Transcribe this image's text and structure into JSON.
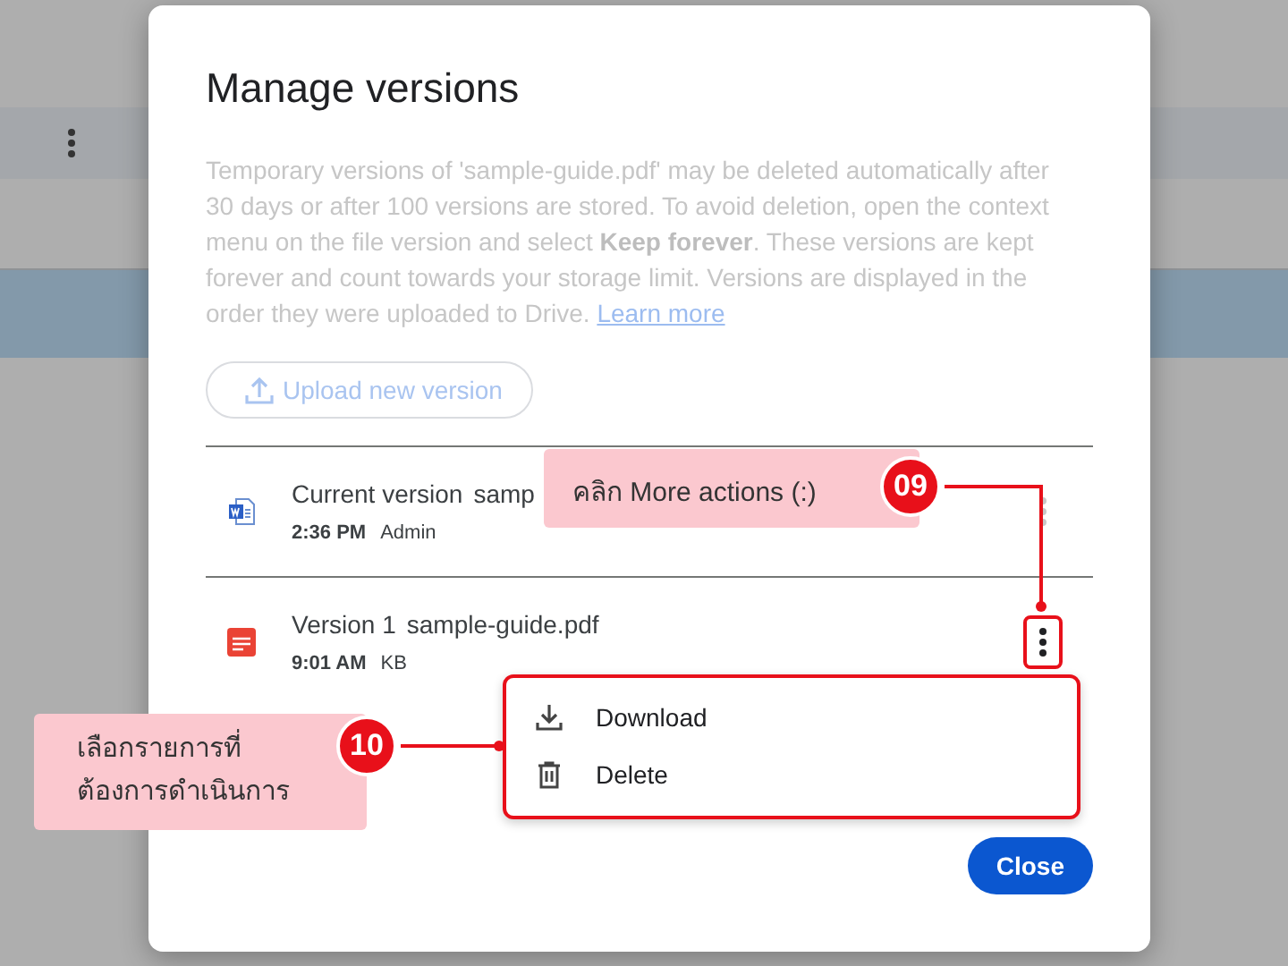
{
  "dialog": {
    "title": "Manage versions",
    "description": "Temporary versions of 'sample-guide.pdf' may be deleted automatically after 30 days or after 100 versions are stored. To avoid deletion, open the context menu on the file version and select **Keep forever**. These versions are kept forever and count towards your storage limit. Versions are displayed in the order they were uploaded to Drive.",
    "link": "Learn more",
    "upload_button": "Upload new version",
    "versions": [
      {
        "name": "Current version",
        "file": "samp",
        "time": "2:36 PM",
        "owner": "Admin",
        "kind": "word",
        "highlighted": false
      },
      {
        "name": "Version 1",
        "file": "sample-guide.pdf",
        "time": "9:01 AM",
        "owner": "KB",
        "kind": "pdf",
        "highlighted": true
      }
    ],
    "menu": {
      "items": [
        {
          "label": "Download",
          "kind": "download"
        },
        {
          "label": "Delete",
          "kind": "delete"
        }
      ]
    },
    "close_button": "Close"
  },
  "annotations": [
    {
      "number": "09",
      "text": "คลิก More actions (:)"
    },
    {
      "number": "10",
      "text": "เลือกรายการที่\nต้องการดำเนินการ"
    }
  ]
}
